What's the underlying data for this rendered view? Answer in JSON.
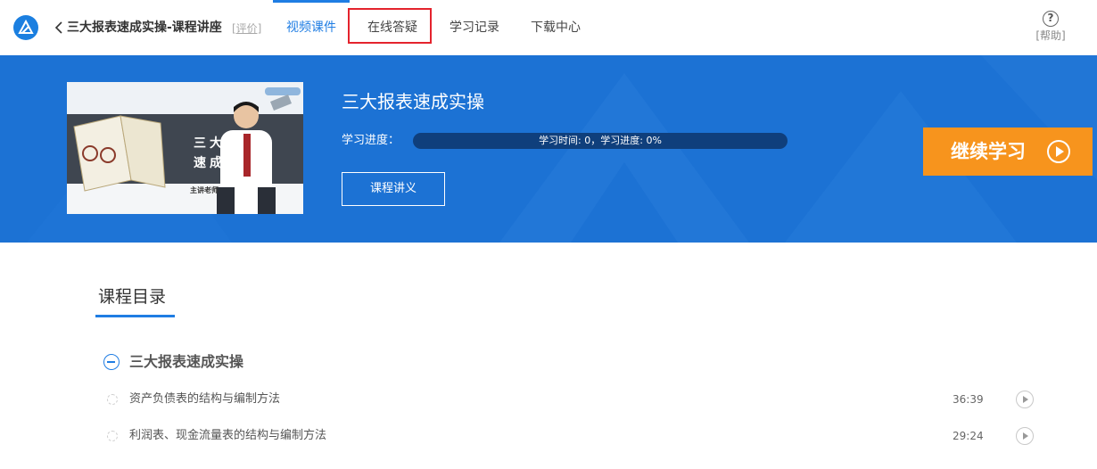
{
  "header": {
    "course_title": "三大报表速成实操-课程讲座",
    "review_link": "[评价]",
    "tabs": [
      {
        "label": "视频课件",
        "active": true
      },
      {
        "label": "在线答疑",
        "active": false
      },
      {
        "label": "学习记录",
        "active": false
      },
      {
        "label": "下载中心",
        "active": false
      }
    ],
    "help_icon": "?",
    "help_label": "[帮助]"
  },
  "banner": {
    "title": "三大报表速成实操",
    "progress_label": "学习进度：",
    "progress_text": "学习时间: 0，学习进度: 0%",
    "progress_fraction": 0,
    "handout_button": "课程讲义",
    "continue_button": "继续学习",
    "thumbnail_text_1": "三大报",
    "thumbnail_text_2": "速成",
    "thumbnail_text_3": "主讲老师"
  },
  "catalog": {
    "title": "课程目录",
    "chapters": [
      {
        "title": "三大报表速成实操",
        "lessons": [
          {
            "title": "资产负债表的结构与编制方法",
            "duration": "36:39"
          },
          {
            "title": "利润表、现金流量表的结构与编制方法",
            "duration": "29:24"
          }
        ]
      }
    ]
  },
  "colors": {
    "accent": "#1f7de3",
    "banner": "#1c72d4",
    "continue": "#f7941d",
    "highlight": "#e4232d"
  }
}
